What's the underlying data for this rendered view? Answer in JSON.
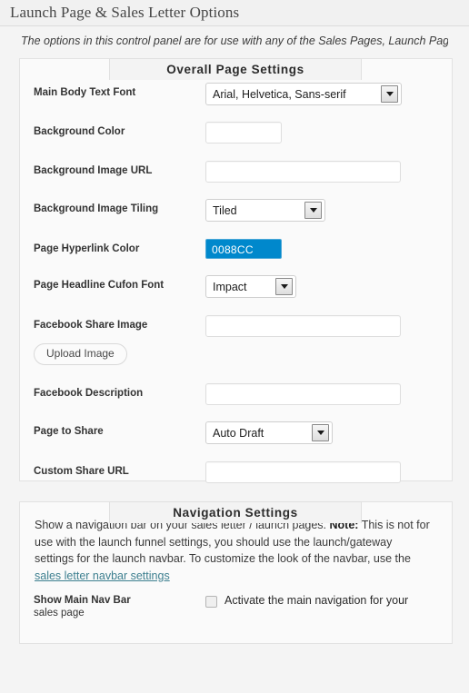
{
  "window": {
    "title": "Launch Page & Sales Letter Options"
  },
  "intro": {
    "text": "The options in this control panel are for use with any of the Sales Pages, Launch Pages."
  },
  "colors": {
    "link_accent": "#0088CC",
    "nav_link": "#3d7f8f"
  },
  "sections": [
    {
      "id": "overall",
      "title": "Overall Page Settings",
      "fields": {
        "main_body_font": {
          "label": "Main Body Text Font",
          "value": "Arial, Helvetica, Sans-serif",
          "type": "select"
        },
        "background_color": {
          "label": "Background Color",
          "value": "",
          "type": "text"
        },
        "background_image_url": {
          "label": "Background Image URL",
          "value": "",
          "type": "text"
        },
        "background_image_tiling": {
          "label": "Background Image Tiling",
          "value": "Tiled",
          "type": "select"
        },
        "page_hyperlink_color": {
          "label": "Page Hyperlink Color",
          "value": "0088CC",
          "type": "color"
        },
        "page_headline_cufon_font": {
          "label": "Page Headline Cufon Font",
          "value": "Impact",
          "type": "select"
        },
        "facebook_share_image": {
          "label": "Facebook Share Image",
          "value": "",
          "type": "text",
          "button_label": "Upload Image"
        },
        "facebook_description": {
          "label": "Facebook Description",
          "value": "",
          "type": "text"
        },
        "page_to_share": {
          "label": "Page to Share",
          "value": "Auto Draft",
          "type": "select"
        },
        "custom_share_url": {
          "label": "Custom Share URL",
          "value": "",
          "type": "text"
        }
      }
    },
    {
      "id": "navigation",
      "title": "Navigation Settings",
      "description": {
        "part1": "Show a navigation bar on your sales letter / launch pages. ",
        "note_label": "Note:",
        "part2": " This is not for use with the launch funnel settings, you should use the launch/gateway settings for the launch navbar. To customize the look of the navbar, use the ",
        "link_text": "sales letter navbar settings"
      },
      "fields": {
        "show_main_nav_bar": {
          "label_bold": "Show Main Nav Bar",
          "label_regular": "sales page",
          "checkbox_label": "Activate the main navigation for your",
          "checked": false
        }
      }
    }
  ]
}
